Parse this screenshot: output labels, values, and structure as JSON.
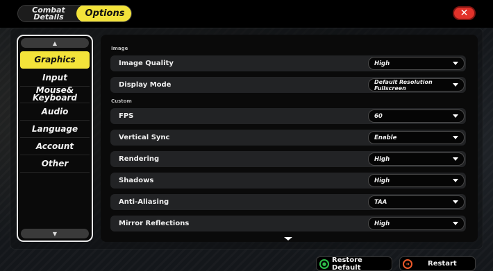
{
  "tabs": {
    "combat_details": "Combat\nDetails",
    "options": "Options"
  },
  "close_icon": "close-icon",
  "sidebar": {
    "items": [
      {
        "label": "Graphics",
        "active": true
      },
      {
        "label": "Input"
      },
      {
        "label": "Mouse&\nKeyboard"
      },
      {
        "label": "Audio"
      },
      {
        "label": "Language"
      },
      {
        "label": "Account"
      },
      {
        "label": "Other"
      }
    ]
  },
  "sections": {
    "image": "Image",
    "custom": "Custom"
  },
  "settings": [
    {
      "label": "Image Quality",
      "value": "High"
    },
    {
      "label": "Display Mode",
      "value": "Default Resolution Fullscreen"
    },
    {
      "label": "FPS",
      "value": "60"
    },
    {
      "label": "Vertical Sync",
      "value": "Enable"
    },
    {
      "label": "Rendering",
      "value": "High"
    },
    {
      "label": "Shadows",
      "value": "High"
    },
    {
      "label": "Anti-Aliasing",
      "value": "TAA"
    },
    {
      "label": "Mirror Reflections",
      "value": "High"
    }
  ],
  "footer": {
    "restore_default": "Restore Default",
    "restart": "Restart"
  },
  "colors": {
    "accent": "#f3e33a",
    "close": "#e2322a",
    "restore_icon": "#2fbf4a",
    "restart_icon": "#f05a2a"
  }
}
